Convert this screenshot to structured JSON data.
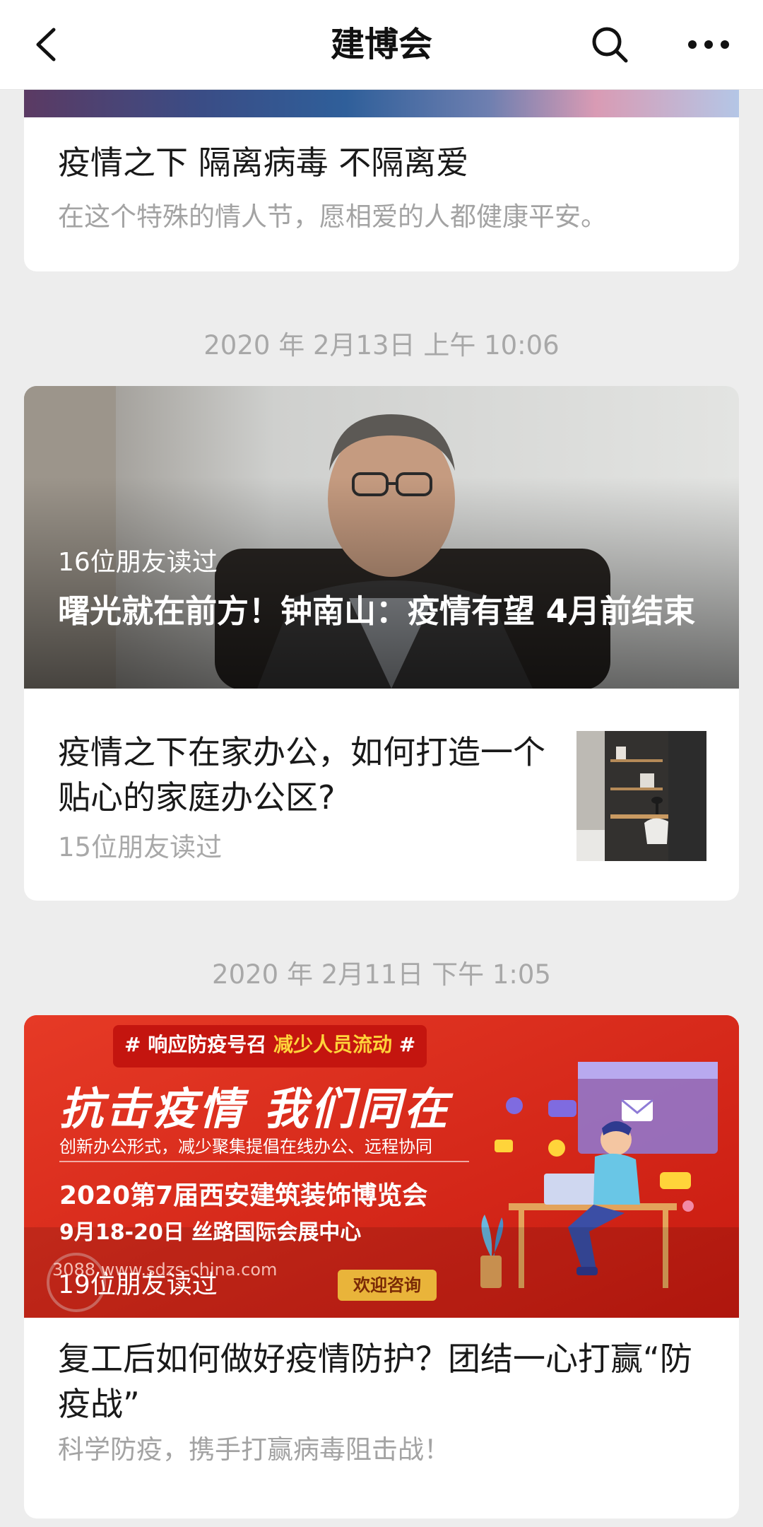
{
  "navbar": {
    "title": "建博会",
    "back_icon": "chevron-left-icon",
    "search_icon": "search-icon",
    "more_icon": "more-dots-icon"
  },
  "articles": [
    {
      "title": "疫情之下 隔离病毒 不隔离爱",
      "description": "在这个特殊的情人节，愿相爱的人都健康平安。"
    }
  ],
  "groups": [
    {
      "date": "2020 年 2月13日 上午 10:06",
      "main": {
        "reads": "16位朋友读过",
        "headline": "曙光就在前方！钟南山：疫情有望 4月前结束"
      },
      "sub": {
        "title": "疫情之下在家办公，如何打造一个贴心的家庭办公区?",
        "reads": "15位朋友读过"
      }
    },
    {
      "date": "2020 年 2月11日 下午 1:05",
      "main": {
        "reads": "19位朋友读过",
        "poster": {
          "tag_prefix": "# 响应防疫号召",
          "tag_highlight": "减少人员流动",
          "tag_suffix": "#",
          "headline": "抗击疫情 我们同在",
          "subline": "创新办公形式，减少聚集提倡在线办公、远程协同",
          "expo": "2020第7届西安建筑装饰博览会",
          "when": "9月18-20日  丝路国际会展中心",
          "contact": "3088  www.sdzs-china.com",
          "button": "欢迎咨询"
        },
        "title": "复工后如何做好疫情防护？团结一心打赢“防疫战”",
        "description": "科学防疫，携手打赢病毒阻击战！"
      }
    }
  ],
  "colors": {
    "background": "#ededed",
    "card": "#ffffff",
    "poster_red": "#dc2a1c",
    "highlight_yellow": "#ffd43a"
  }
}
